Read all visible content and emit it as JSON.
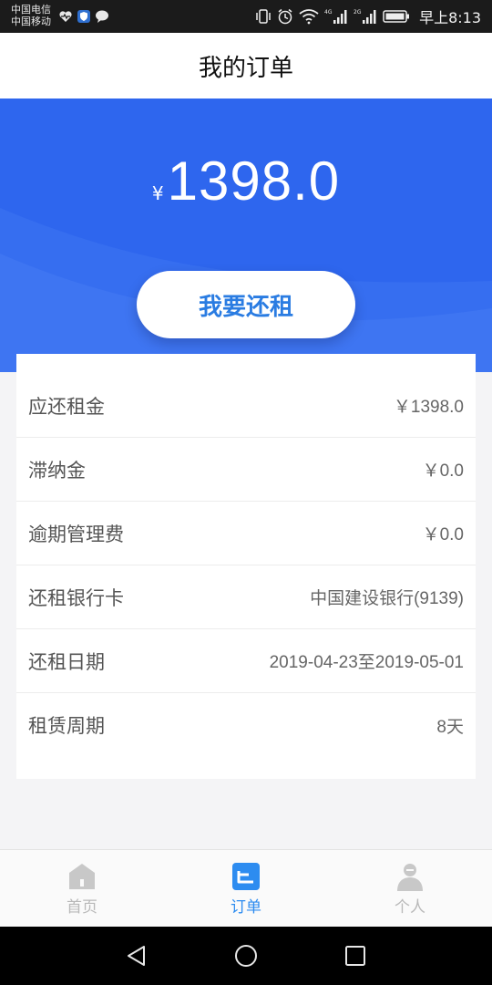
{
  "status_bar": {
    "carrier_1": "中国电信",
    "carrier_2": "中国移动",
    "net_1": "4G",
    "net_2": "2G",
    "time": "早上8:13",
    "icons": [
      "health-icon",
      "shield-icon",
      "chat-bubble-icon",
      "vibrate-icon",
      "alarm-icon",
      "wifi-icon",
      "signal-icon",
      "battery-icon"
    ]
  },
  "header": {
    "title": "我的订单"
  },
  "hero": {
    "currency": "¥",
    "amount": "1398.0",
    "pay_button_label": "我要还租",
    "colors": {
      "background": "#2e66ee",
      "button_text": "#2a7ce2"
    }
  },
  "details": {
    "rows": [
      {
        "label": "应还租金",
        "value": "￥1398.0"
      },
      {
        "label": "滞纳金",
        "value": "￥0.0"
      },
      {
        "label": "逾期管理费",
        "value": "￥0.0"
      },
      {
        "label": "还租银行卡",
        "value": "中国建设银行(9139)"
      },
      {
        "label": "还租日期",
        "value": "2019-04-23至2019-05-01"
      },
      {
        "label": "租赁周期",
        "value": "8天"
      }
    ]
  },
  "bottom_nav": {
    "items": [
      {
        "label": "首页",
        "icon": "home-icon",
        "active": false
      },
      {
        "label": "订单",
        "icon": "order-icon",
        "active": true
      },
      {
        "label": "个人",
        "icon": "person-icon",
        "active": false
      }
    ],
    "colors": {
      "active": "#2d8cf0",
      "inactive": "#b9b9b9"
    }
  },
  "system_nav": {
    "icons": [
      "back-icon",
      "home-circle-icon",
      "recents-icon"
    ]
  }
}
